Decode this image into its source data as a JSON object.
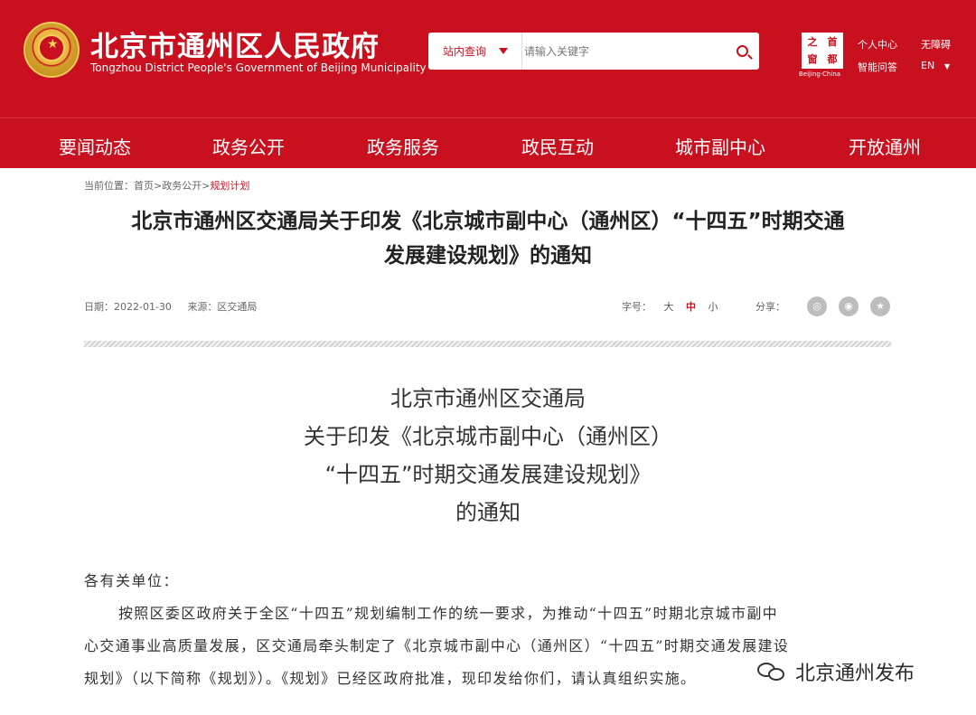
{
  "header": {
    "title": "北京市通州区人民政府",
    "subtitle": "Tongzhou District People's Government of Beijing Municipality",
    "search": {
      "scope_label": "站内查询",
      "placeholder": "请输入关键字"
    },
    "capital_logo": {
      "chars": [
        "之",
        "首",
        "窗",
        "都"
      ],
      "caption": "Beijing·China"
    },
    "links": {
      "personal_center": "个人中心",
      "accessibility": "无障碍",
      "smart_qa": "智能问答",
      "language": "EN"
    }
  },
  "nav": {
    "items": [
      "要闻动态",
      "政务公开",
      "政务服务",
      "政民互动",
      "城市副中心",
      "开放通州"
    ]
  },
  "breadcrumb": {
    "prefix": "当前位置：",
    "home": "首页",
    "sep1": ">",
    "section": "政务公开",
    "sep2": ">",
    "current": "规划计划"
  },
  "article": {
    "title_line1": "北京市通州区交通局关于印发《北京城市副中心（通州区）“十四五”时期交通",
    "title_line2": "发展建设规划》的通知",
    "date": "日期：2022-01-30",
    "source": "来源：区交通局",
    "font_size_label": "字号：",
    "font_sizes": [
      "大",
      "中",
      "小"
    ],
    "font_size_active": "中",
    "share_label": "分享：",
    "share_icons": [
      "wechat-icon",
      "weibo-icon",
      "favorite-icon"
    ]
  },
  "document": {
    "heading": [
      "北京市通州区交通局",
      "关于印发《北京城市副中心（通州区）",
      "“十四五”时期交通发展建设规划》",
      "的通知"
    ],
    "salutation": "各有关单位：",
    "paragraph_lines": [
      "按照区委区政府关于全区“十四五”规划编制工作的统一要求，为推动“十四五”时期北京城市副中",
      "心交通事业高质量发展，区交通局牵头制定了《北京城市副中心（通州区）“十四五”时期交通发展建设",
      "规划》（以下简称《规划》）。《规划》已经区政府批准，现印发给你们，请认真组织实施。"
    ]
  },
  "watermark": {
    "text": "北京通州发布"
  },
  "colors": {
    "brand_red": "#c8101f",
    "text": "#333333"
  }
}
